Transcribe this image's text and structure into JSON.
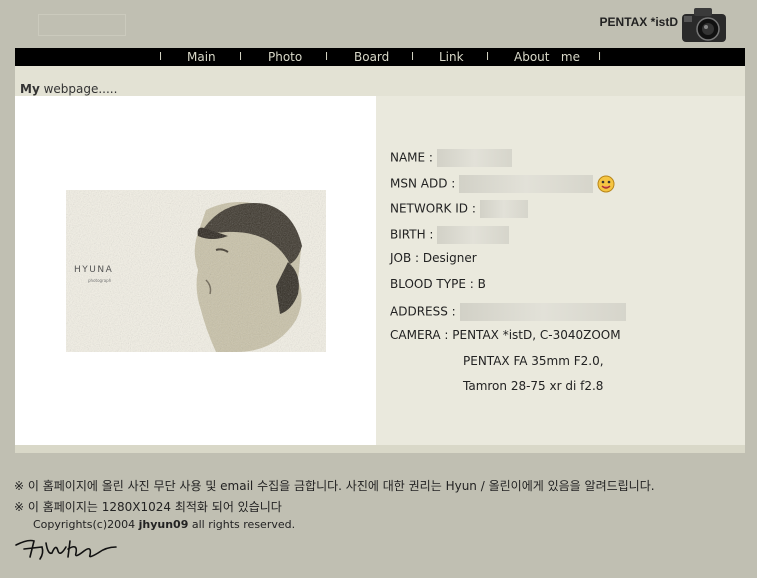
{
  "header": {
    "brand": "PENTAX *istD",
    "icon": "camera-icon"
  },
  "nav": {
    "separator": "l",
    "items": [
      {
        "label": "Main"
      },
      {
        "label": "Photo"
      },
      {
        "label": "Board"
      },
      {
        "label": "Link"
      },
      {
        "label": "About   me"
      }
    ]
  },
  "subbar": {
    "title_bold": "My",
    "title_rest": " webpage....."
  },
  "photo": {
    "caption": "HYUNA",
    "caption_small": "photograph"
  },
  "profile": {
    "name_label": "NAME :",
    "msn_label": "MSN ADD :",
    "network_label": "NETWORK ID :",
    "birth_label": "BIRTH :",
    "job": "JOB : Designer",
    "blood": "BLOOD TYPE : B",
    "address_label": "ADDRESS :",
    "camera": "CAMERA : PENTAX *istD, C-3040ZOOM",
    "lens1": "PENTAX FA 35mm F2.0,",
    "lens2": "Tamron 28-75 xr di f2.8"
  },
  "footer": {
    "line1": "※ 이 홈페이지에 올린 사진 무단 사용 및 email 수집을 금합니다. 사진에 대한 권리는 Hyun / 올린이에게 있음을 알려드립니다.",
    "line2": "※ 이 홈페이지는 1280X1024 최적화 되어 있습니다",
    "copyright_pre": "Copyrights(c)2004 ",
    "copyright_bold": "jhyun09",
    "copyright_post": " all rights reserved."
  }
}
